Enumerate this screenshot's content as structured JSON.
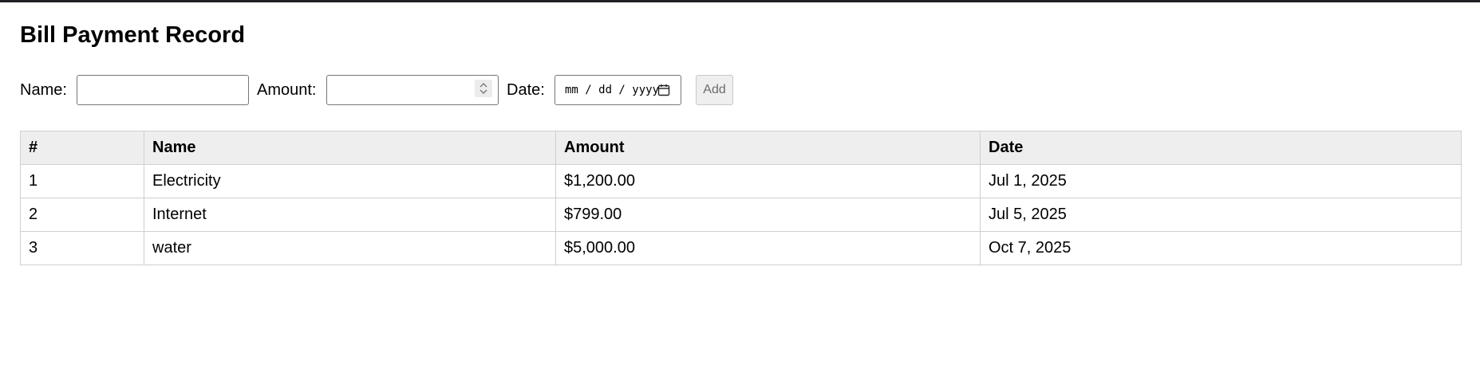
{
  "page": {
    "title": "Bill Payment Record"
  },
  "form": {
    "name_label": "Name:",
    "name_value": "",
    "amount_label": "Amount:",
    "amount_value": "",
    "date_label": "Date:",
    "date_placeholder": "mm / dd / yyyy",
    "add_label": "Add"
  },
  "table": {
    "headers": [
      "#",
      "Name",
      "Amount",
      "Date"
    ],
    "rows": [
      [
        "1",
        "Electricity",
        "$1,200.00",
        "Jul 1, 2025"
      ],
      [
        "2",
        "Internet",
        "$799.00",
        "Jul 5, 2025"
      ],
      [
        "3",
        "water",
        "$5,000.00",
        "Oct 7, 2025"
      ]
    ]
  },
  "icons": {
    "amount_spinner": "spinner-icon",
    "date_picker": "calendar-icon"
  }
}
